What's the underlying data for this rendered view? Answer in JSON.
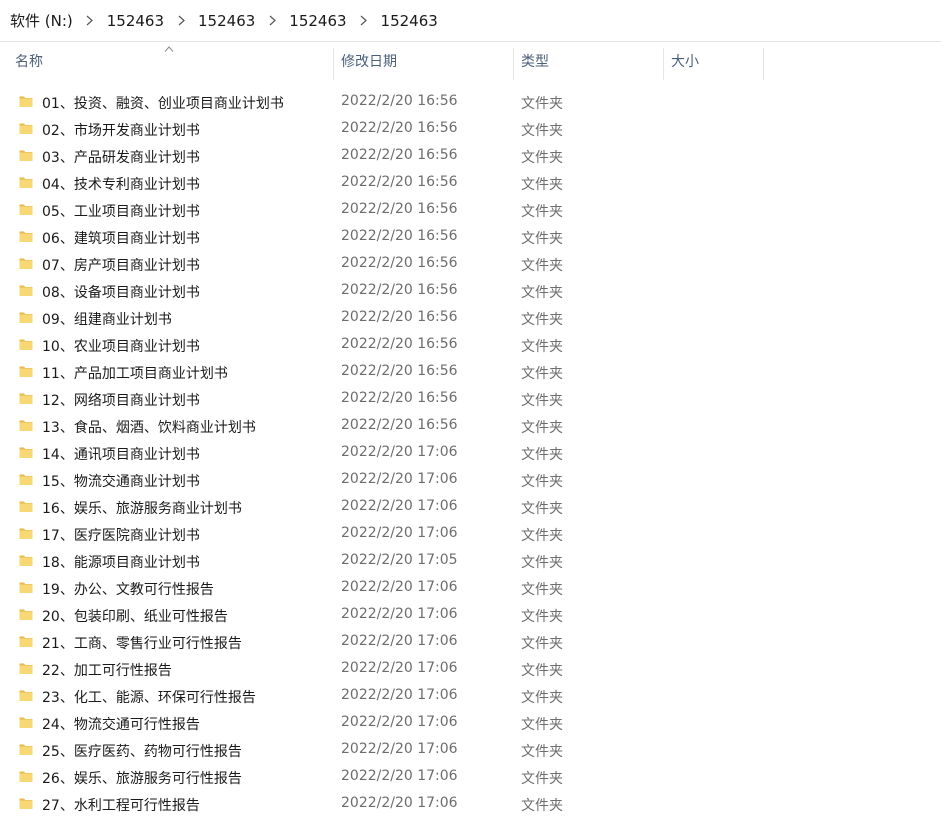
{
  "breadcrumb": {
    "items": [
      "软件 (N:)",
      "152463",
      "152463",
      "152463",
      "152463"
    ]
  },
  "columns": {
    "name": "名称",
    "date": "修改日期",
    "type": "类型",
    "size": "大小"
  },
  "colors": {
    "folder": "#f8d775",
    "folder_dark": "#e6b94a"
  },
  "icons": {
    "folder": "folder-icon",
    "separator": "chevron-right-icon",
    "sort": "sort-up-icon"
  },
  "files": [
    {
      "name": "01、投资、融资、创业项目商业计划书",
      "date": "2022/2/20 16:56",
      "type": "文件夹"
    },
    {
      "name": "02、市场开发商业计划书",
      "date": "2022/2/20 16:56",
      "type": "文件夹"
    },
    {
      "name": "03、产品研发商业计划书",
      "date": "2022/2/20 16:56",
      "type": "文件夹"
    },
    {
      "name": "04、技术专利商业计划书",
      "date": "2022/2/20 16:56",
      "type": "文件夹"
    },
    {
      "name": "05、工业项目商业计划书",
      "date": "2022/2/20 16:56",
      "type": "文件夹"
    },
    {
      "name": "06、建筑项目商业计划书",
      "date": "2022/2/20 16:56",
      "type": "文件夹"
    },
    {
      "name": "07、房产项目商业计划书",
      "date": "2022/2/20 16:56",
      "type": "文件夹"
    },
    {
      "name": "08、设备项目商业计划书",
      "date": "2022/2/20 16:56",
      "type": "文件夹"
    },
    {
      "name": "09、组建商业计划书",
      "date": "2022/2/20 16:56",
      "type": "文件夹"
    },
    {
      "name": "10、农业项目商业计划书",
      "date": "2022/2/20 16:56",
      "type": "文件夹"
    },
    {
      "name": "11、产品加工项目商业计划书",
      "date": "2022/2/20 16:56",
      "type": "文件夹"
    },
    {
      "name": "12、网络项目商业计划书",
      "date": "2022/2/20 16:56",
      "type": "文件夹"
    },
    {
      "name": "13、食品、烟酒、饮料商业计划书",
      "date": "2022/2/20 16:56",
      "type": "文件夹"
    },
    {
      "name": "14、通讯项目商业计划书",
      "date": "2022/2/20 17:06",
      "type": "文件夹"
    },
    {
      "name": "15、物流交通商业计划书",
      "date": "2022/2/20 17:06",
      "type": "文件夹"
    },
    {
      "name": "16、娱乐、旅游服务商业计划书",
      "date": "2022/2/20 17:06",
      "type": "文件夹"
    },
    {
      "name": "17、医疗医院商业计划书",
      "date": "2022/2/20 17:06",
      "type": "文件夹"
    },
    {
      "name": "18、能源项目商业计划书",
      "date": "2022/2/20 17:05",
      "type": "文件夹"
    },
    {
      "name": "19、办公、文教可行性报告",
      "date": "2022/2/20 17:06",
      "type": "文件夹"
    },
    {
      "name": "20、包装印刷、纸业可性报告",
      "date": "2022/2/20 17:06",
      "type": "文件夹"
    },
    {
      "name": "21、工商、零售行业可行性报告",
      "date": "2022/2/20 17:06",
      "type": "文件夹"
    },
    {
      "name": "22、加工可行性报告",
      "date": "2022/2/20 17:06",
      "type": "文件夹"
    },
    {
      "name": "23、化工、能源、环保可行性报告",
      "date": "2022/2/20 17:06",
      "type": "文件夹"
    },
    {
      "name": "24、物流交通可行性报告",
      "date": "2022/2/20 17:06",
      "type": "文件夹"
    },
    {
      "name": "25、医疗医药、药物可行性报告",
      "date": "2022/2/20 17:06",
      "type": "文件夹"
    },
    {
      "name": "26、娱乐、旅游服务可行性报告",
      "date": "2022/2/20 17:06",
      "type": "文件夹"
    },
    {
      "name": "27、水利工程可行性报告",
      "date": "2022/2/20 17:06",
      "type": "文件夹"
    }
  ]
}
